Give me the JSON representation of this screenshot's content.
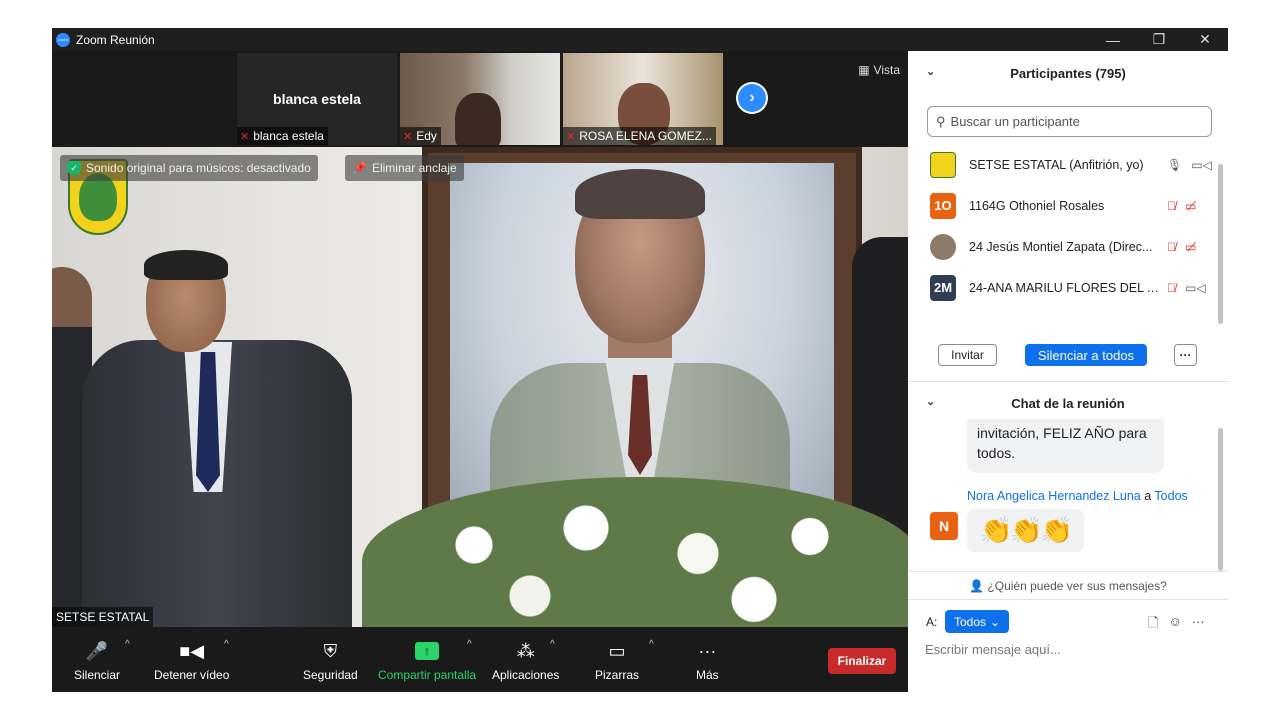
{
  "window": {
    "title": "Zoom Reunión",
    "controls": [
      "—",
      "❐",
      "✕"
    ]
  },
  "strip": {
    "tiles": [
      {
        "big_label": "blanca estela",
        "name": "blanca estela"
      },
      {
        "name": "Edy"
      },
      {
        "name": "ROSA ELENA GOMEZ..."
      }
    ],
    "view_label": "Vista"
  },
  "main_video": {
    "sound_notice": "Sonido original para músicos: desactivado",
    "unpin_label": "Eliminar anclaje",
    "speaker_name": "SETSE ESTATAL"
  },
  "toolbar": {
    "mute": "Silenciar",
    "stop_video": "Detener vídeo",
    "security": "Seguridad",
    "share": "Compartir pantalla",
    "apps": "Aplicaciones",
    "whiteboards": "Pizarras",
    "more": "Más",
    "end": "Finalizar"
  },
  "participants": {
    "header": "Participantes (795)",
    "search_placeholder": "Buscar un participante",
    "list": [
      {
        "initials": "",
        "name": "SETSE ESTATAL (Anfitrión, yo)",
        "color": "#f2d21a"
      },
      {
        "initials": "1O",
        "name": "1164G Othoniel Rosales",
        "color": "#e86311"
      },
      {
        "initials": "",
        "name": "24 Jesús Montiel Zapata (Direc...",
        "color": "#8c7a6a"
      },
      {
        "initials": "2M",
        "name": "24-ANA MARILU FLORES DEL A...",
        "color": "#2f3e55"
      }
    ],
    "invite": "Invitar",
    "mute_all": "Silenciar a todos",
    "more": "···"
  },
  "chat": {
    "header": "Chat de la reunión",
    "prev_message": "invitación, FELIZ AÑO para todos.",
    "sender_name": "Nora Angelica Hernandez Luna",
    "sender_connector": "a",
    "sender_target": "Todos",
    "sender_initial": "N",
    "reaction": "👏👏👏",
    "who_can_see": "¿Quién puede ver sus mensajes?",
    "to_label": "A:",
    "to_value": "Todos",
    "composer_placeholder": "Escribir mensaje aquí..."
  }
}
